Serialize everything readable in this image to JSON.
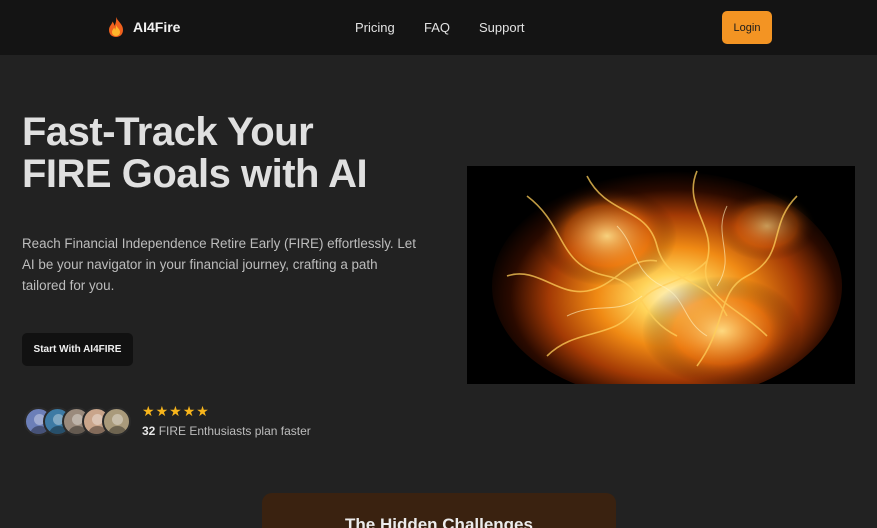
{
  "nav": {
    "brand": "AI4Fire",
    "brand_icon": "flame-icon",
    "links": [
      "Pricing",
      "FAQ",
      "Support"
    ],
    "login_label": "Login"
  },
  "hero": {
    "title_line1": "Fast-Track Your",
    "title_line2": "FIRE Goals with AI",
    "description": "Reach Financial Independence Retire Early (FIRE) effortlessly. Let AI be your navigator in your financial journey, crafting a path tailored for you.",
    "cta_label": "Start With AI4FIRE",
    "rating_stars": 5,
    "enthusiast_count": "32",
    "proof_text": "FIRE Enthusiasts plan faster"
  },
  "section": {
    "title": "The Hidden Challenges"
  },
  "colors": {
    "accent": "#f39423",
    "background": "#222222",
    "navbar": "#141414",
    "star": "#f7b51c"
  }
}
